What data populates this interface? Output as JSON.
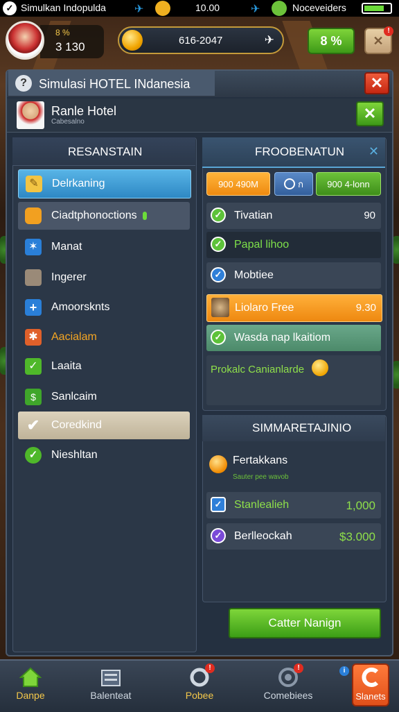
{
  "status_bar": {
    "carrier": "Simulkan Indopulda",
    "time": "10.00",
    "network": "Noceveiders"
  },
  "hud": {
    "level_small": "8 %",
    "level_value": "3 130",
    "coins": "616-2047",
    "btn_green": "8 %"
  },
  "panel": {
    "title": "Simulasi HOTEL INdanesia",
    "hotel_name": "Ranle Hotel",
    "hotel_sub": "Cabesalno"
  },
  "left": {
    "header": "RESANSTAIN",
    "items": [
      {
        "label": "Delrkaning",
        "icon": "pencil-icon",
        "state": "active"
      },
      {
        "label": "Ciadtphonoctions",
        "icon": "coin-icon",
        "state": "highlight"
      },
      {
        "label": "Manat",
        "icon": "star-burst-icon",
        "state": "normal"
      },
      {
        "label": "Ingerer",
        "icon": "toolbox-icon",
        "state": "normal"
      },
      {
        "label": "Amoorsknts",
        "icon": "plus-icon",
        "state": "normal"
      },
      {
        "label": "Aacialam",
        "icon": "asterisk-icon",
        "state": "warning"
      },
      {
        "label": "Laaita",
        "icon": "check-square-icon",
        "state": "normal"
      },
      {
        "label": "Sanlcaim",
        "icon": "money-icon",
        "state": "normal"
      },
      {
        "label": "Coredkind",
        "icon": "checkmark-icon",
        "state": "selected"
      },
      {
        "label": "Nieshltan",
        "icon": "check-circle-icon",
        "state": "normal"
      }
    ]
  },
  "right": {
    "header": "FROOBENATUN",
    "tabs": [
      "900 490M",
      "ก",
      "900 4-lonn"
    ],
    "items": [
      {
        "label": "Tivatian",
        "value": "90",
        "check": "green",
        "style": "normal"
      },
      {
        "label": "Papal lihoo",
        "value": "",
        "check": "green",
        "style": "dark"
      },
      {
        "label": "Mobtiee",
        "value": "",
        "check": "blue",
        "style": "normal"
      },
      {
        "label": "Liolaro Free",
        "value": "9.30",
        "check": "crate",
        "style": "orange"
      },
      {
        "label": "Wasda nap lkaitiom",
        "value": "",
        "check": "green",
        "style": "green"
      }
    ],
    "note": "Prokalc Canianlarde"
  },
  "summary": {
    "header": "SIMMARETAJINIO",
    "line1": "Fertakkans",
    "line1_sub": "Sauter pee wavob",
    "rows": [
      {
        "label": "Stanlealieh",
        "value": "1,000"
      },
      {
        "label": "Berlleockah",
        "value": "$3.000"
      }
    ],
    "confirm": "Catter Nanign"
  },
  "nav": [
    {
      "label": "Danpe",
      "icon": "home-icon"
    },
    {
      "label": "Balenteat",
      "icon": "building-icon"
    },
    {
      "label": "Pobee",
      "icon": "ring-icon"
    },
    {
      "label": "Comebiees",
      "icon": "gear-ring-icon"
    },
    {
      "label": "Slanets",
      "icon": "c-logo-icon"
    }
  ]
}
